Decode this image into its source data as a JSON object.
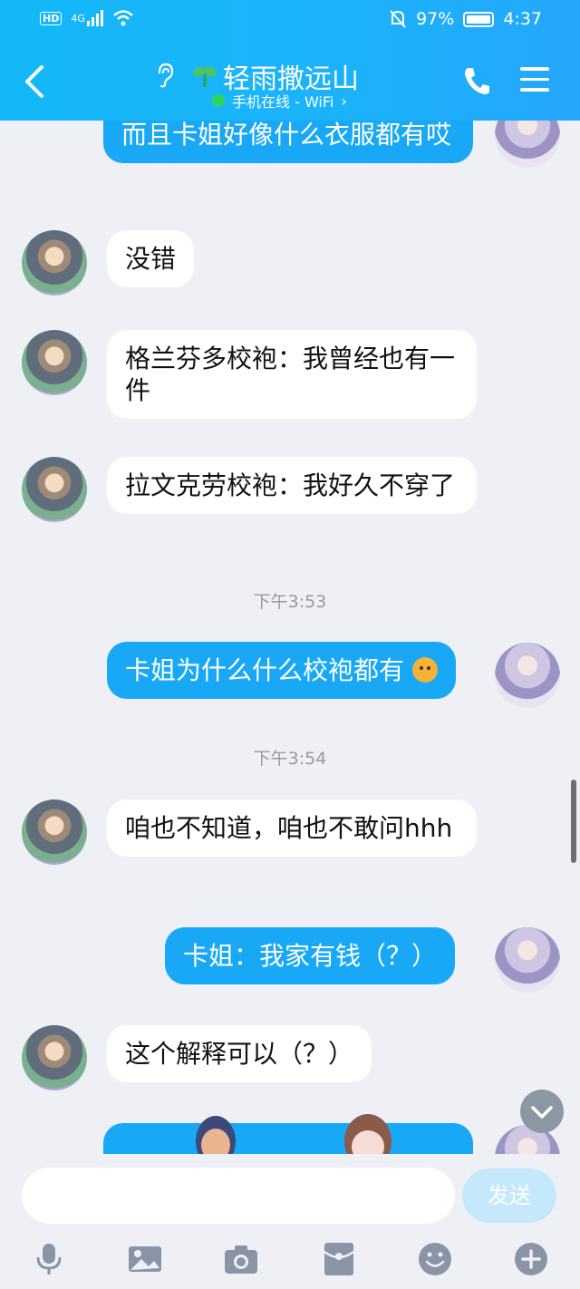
{
  "status_bar": {
    "network": "4G",
    "hd": "HD",
    "battery": "97%",
    "time": "4:37"
  },
  "header": {
    "title": "轻雨撒远山",
    "subtitle": "手机在线 - WiFi",
    "subtitle_arrow": "›",
    "colors": {
      "bg": "#1bb4fa",
      "online_dot": "#2ed25e"
    }
  },
  "messages": [
    {
      "side": "out",
      "text": "而且卡姐好像什么衣服都有哎"
    },
    {
      "side": "in",
      "text": "没错"
    },
    {
      "side": "in",
      "text": "格兰芬多校袍：我曾经也有一件"
    },
    {
      "side": "in",
      "text": "拉文克劳校袍：我好久不穿了"
    },
    {
      "time": "下午3:53"
    },
    {
      "side": "out",
      "text": "卡姐为什么什么校袍都有",
      "emoji": "dog-face-emoji"
    },
    {
      "time": "下午3:54"
    },
    {
      "side": "in",
      "text": "咱也不知道，咱也不敢问hhh"
    },
    {
      "side": "out",
      "text": "卡姐：我家有钱（？）"
    },
    {
      "side": "in",
      "text": "这个解释可以（？）"
    }
  ],
  "input": {
    "placeholder": "",
    "send_label": "发送"
  },
  "toolbar": [
    "microphone-icon",
    "image-icon",
    "camera-icon",
    "red-packet-icon",
    "emoji-icon",
    "plus-icon"
  ]
}
